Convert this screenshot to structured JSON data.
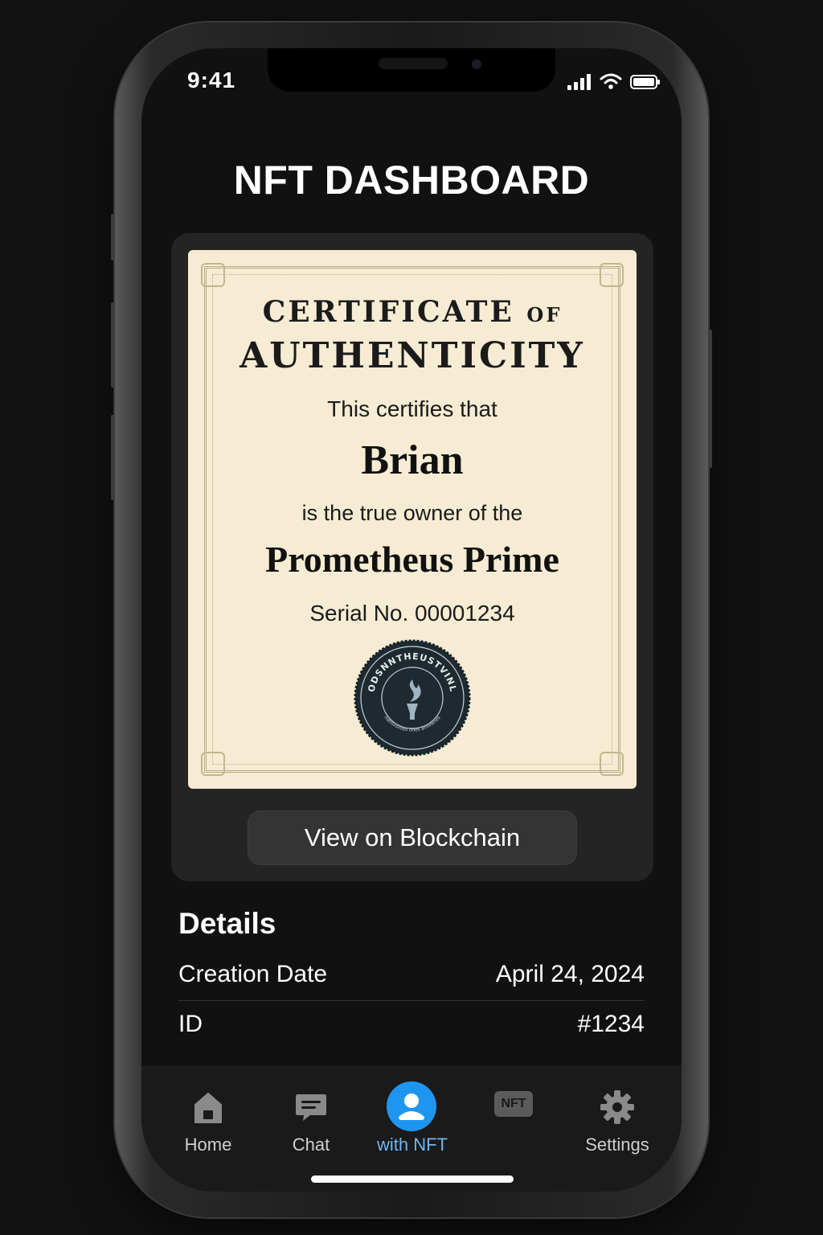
{
  "status_bar": {
    "time": "9:41"
  },
  "app": {
    "title": "NFT DASHBOARD"
  },
  "certificate": {
    "title_word1": "CERTIFICATE",
    "title_word2": "OF",
    "title_line2": "AUTHENTICITY",
    "certifies_text": "This certifies that",
    "owner_name": "Brian",
    "owner_text": "is the true owner of the",
    "item_name": "Prometheus Prime",
    "serial": "Serial No. 00001234",
    "seal_top_text": "ODSNNTHEUSTVINL",
    "seal_bottom_text": "ndnsxsilteo ones Bnnrenes"
  },
  "actions": {
    "view_blockchain": "View on Blockchain"
  },
  "details": {
    "title": "Details",
    "rows": [
      {
        "label": "Creation Date",
        "value": "April 24, 2024"
      },
      {
        "label": "ID",
        "value": "#1234"
      }
    ]
  },
  "tabbar": {
    "tabs": [
      {
        "label": "Home",
        "icon": "home-icon"
      },
      {
        "label": "Chat",
        "icon": "chat-icon"
      },
      {
        "label": "with NFT",
        "icon": "profile-icon",
        "active": true
      },
      {
        "label": "",
        "icon": "nft-icon",
        "icon_text": "NFT"
      },
      {
        "label": "Settings",
        "icon": "gear-icon"
      }
    ]
  },
  "colors": {
    "background": "#121212",
    "screen": "#111111",
    "card": "#242424",
    "certificate_paper": "#f5ecd3",
    "accent": "#1e96f0",
    "active_label": "#6fb6f5"
  }
}
